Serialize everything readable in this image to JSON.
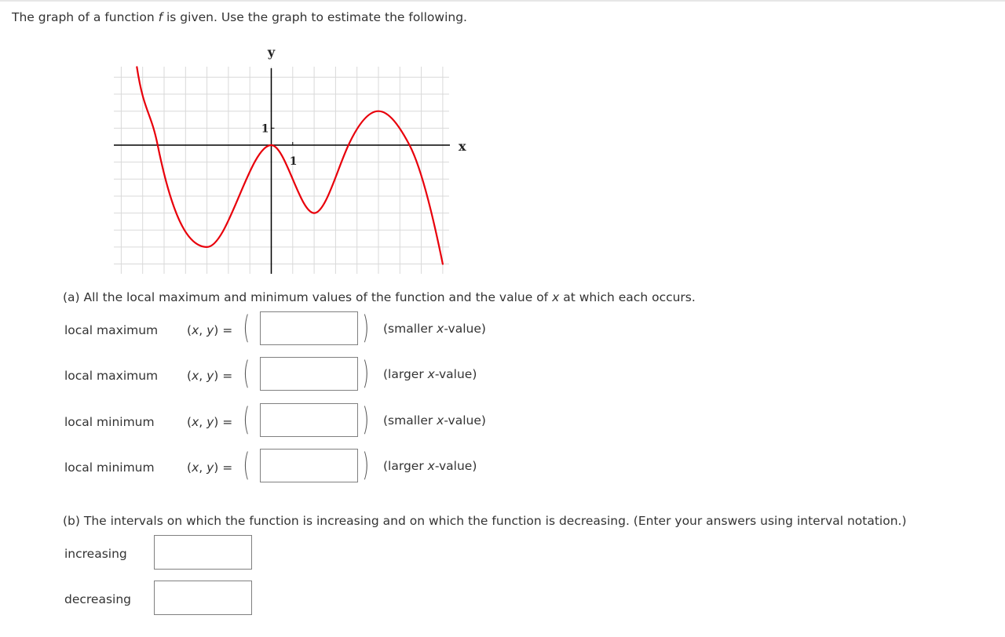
{
  "intro": {
    "before_f": "The graph of a function ",
    "f": "f",
    "after_f": " is given. Use the graph to estimate the following."
  },
  "chart_data": {
    "type": "line",
    "title": "",
    "xlabel": "x",
    "ylabel": "y",
    "x_tick_label": "1",
    "y_tick_label": "1",
    "xlim": [
      -7,
      8
    ],
    "ylim": [
      -7,
      4
    ],
    "grid": true,
    "grid_step": 1,
    "series": [
      {
        "name": "f",
        "color": "#e8000b",
        "points": [
          {
            "x": -6.27,
            "y": 4.6,
            "slope": -8.2
          },
          {
            "x": -5.3,
            "y": 0,
            "slope": -6.2
          },
          {
            "x": -3,
            "y": -6,
            "slope": 0
          },
          {
            "x": 0,
            "y": 0,
            "slope": 0
          },
          {
            "x": 2,
            "y": -4,
            "slope": 0
          },
          {
            "x": 3.6,
            "y": 0,
            "slope": 2.7
          },
          {
            "x": 5,
            "y": 2,
            "slope": 0
          },
          {
            "x": 6.45,
            "y": 0,
            "slope": -2.4
          },
          {
            "x": 8,
            "y": -7,
            "slope": -6.2
          }
        ]
      }
    ],
    "local_maxima": [
      {
        "x": 0,
        "y": 0
      },
      {
        "x": 5,
        "y": 2
      }
    ],
    "local_minima": [
      {
        "x": -3,
        "y": -6
      },
      {
        "x": 2,
        "y": -4
      }
    ]
  },
  "part_a": {
    "prompt_before_x": "(a) All the local maximum and minimum values of the function and the value of ",
    "x": "x",
    "prompt_after_x": " at which each occurs.",
    "xy_label": {
      "open": "(",
      "x": "x",
      "comma": ", ",
      "y": "y",
      "close": ") ="
    },
    "rows": [
      {
        "label": "local maximum",
        "value": "",
        "note_open": "(smaller ",
        "note_x": "x",
        "note_close": "-value)"
      },
      {
        "label": "local maximum",
        "value": "",
        "note_open": "(larger ",
        "note_x": "x",
        "note_close": "-value)"
      },
      {
        "label": "local minimum",
        "value": "",
        "note_open": "(smaller ",
        "note_x": "x",
        "note_close": "-value)"
      },
      {
        "label": "local minimum",
        "value": "",
        "note_open": "(larger ",
        "note_x": "x",
        "note_close": "-value)"
      }
    ],
    "paren_open": "(",
    "paren_close": ")"
  },
  "part_b": {
    "prompt": "(b) The intervals on which the function is increasing and on which the function is decreasing. (Enter your answers using interval notation.)",
    "increasing_label": "increasing",
    "increasing_value": "",
    "decreasing_label": "decreasing",
    "decreasing_value": ""
  }
}
